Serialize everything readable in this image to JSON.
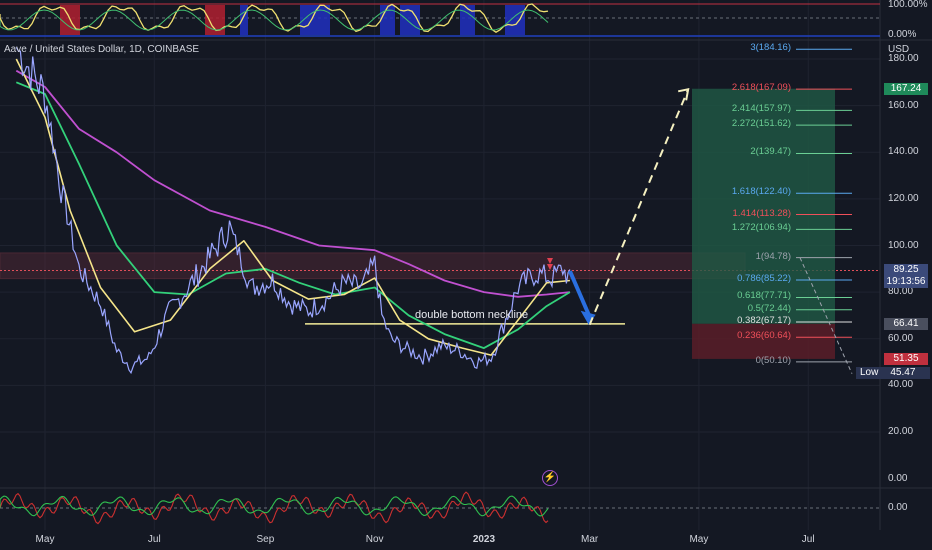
{
  "header": {
    "symbol_title": "Aave / United States Dollar, 1D, COINBASE",
    "currency": "USD"
  },
  "colors": {
    "bg": "#141823",
    "grid": "#1f2330",
    "up": "#9aa6ff",
    "ma_yellow": "#f5e58a",
    "ma_green": "#33d17a",
    "ma_magenta": "#c050d0",
    "resistance_line": "#e0505a",
    "neckline": "#f5ed9a",
    "take_profit_zone": "#1f5a45",
    "stop_zone": "#5e1e28",
    "fib_red": "#f0505a",
    "fib_green": "#6bcf94",
    "fib_blue": "#5aa9f0",
    "fib_grey": "#9ea3ad"
  },
  "annotation": {
    "neckline_label": "double bottom neckline"
  },
  "price_tags": {
    "target": "167.24",
    "current": "89.25",
    "countdown": "19:13:56",
    "neckline": "66.41",
    "stop": "51.35",
    "low_label": "Low",
    "low_value": "45.47"
  },
  "oscillator_top": {
    "ticks": [
      "100.00%",
      "0.00%"
    ]
  },
  "oscillator_bottom": {
    "ticks": [
      "0.00"
    ]
  },
  "chart_data": {
    "type": "line",
    "title": "Aave / United States Dollar, 1D, COINBASE",
    "ylabel": "USD",
    "ylim": [
      0,
      190
    ],
    "y_ticks": [
      "20.00",
      "40.00",
      "60.00",
      "80.00",
      "100.00",
      "120.00",
      "140.00",
      "160.00",
      "180.00"
    ],
    "x_ticks": [
      "May",
      "Jul",
      "Sep",
      "Nov",
      "2023",
      "Mar",
      "May",
      "Jul"
    ],
    "x_start": "2022-04-15",
    "series": [
      {
        "key": "price",
        "x": [
          "2022-04-15",
          "2022-05-01",
          "2022-05-10",
          "2022-05-20",
          "2022-06-01",
          "2022-06-10",
          "2022-06-18",
          "2022-06-28",
          "2022-07-08",
          "2022-07-20",
          "2022-08-01",
          "2022-08-12",
          "2022-08-24",
          "2022-09-05",
          "2022-09-15",
          "2022-09-25",
          "2022-10-05",
          "2022-10-15",
          "2022-10-25",
          "2022-11-01",
          "2022-11-05",
          "2022-11-10",
          "2022-11-18",
          "2022-11-28",
          "2022-12-08",
          "2022-12-18",
          "2022-12-28",
          "2023-01-05",
          "2023-01-12",
          "2023-01-20",
          "2023-01-30",
          "2023-02-08",
          "2023-02-14",
          "2023-02-18"
        ],
        "values": [
          185,
          165,
          125,
          90,
          75,
          55,
          48,
          52,
          70,
          82,
          95,
          108,
          82,
          85,
          75,
          72,
          77,
          84,
          82,
          92,
          70,
          60,
          56,
          52,
          57,
          55,
          50,
          52,
          66,
          82,
          88,
          86,
          90,
          85
        ]
      },
      {
        "key": "ma_yellow",
        "x": [
          "2022-04-15",
          "2022-05-01",
          "2022-05-15",
          "2022-06-01",
          "2022-06-20",
          "2022-07-10",
          "2022-08-01",
          "2022-08-20",
          "2022-09-05",
          "2022-09-25",
          "2022-10-15",
          "2022-11-01",
          "2022-11-15",
          "2022-12-01",
          "2022-12-20",
          "2023-01-05",
          "2023-01-20",
          "2023-02-05",
          "2023-02-18"
        ],
        "values": [
          180,
          155,
          115,
          82,
          63,
          68,
          90,
          102,
          85,
          77,
          79,
          86,
          68,
          60,
          56,
          53,
          68,
          84,
          85
        ]
      },
      {
        "key": "ma_green",
        "x": [
          "2022-04-15",
          "2022-05-01",
          "2022-05-20",
          "2022-06-10",
          "2022-07-01",
          "2022-07-20",
          "2022-08-10",
          "2022-09-01",
          "2022-09-20",
          "2022-10-10",
          "2022-11-01",
          "2022-11-20",
          "2022-12-10",
          "2023-01-01",
          "2023-01-20",
          "2023-02-05",
          "2023-02-18"
        ],
        "values": [
          170,
          165,
          135,
          100,
          80,
          79,
          88,
          90,
          84,
          79,
          82,
          70,
          62,
          56,
          64,
          74,
          80
        ]
      },
      {
        "key": "ma_magenta",
        "x": [
          "2022-04-15",
          "2022-05-01",
          "2022-05-20",
          "2022-06-10",
          "2022-07-01",
          "2022-08-01",
          "2022-09-01",
          "2022-10-01",
          "2022-11-01",
          "2022-11-20",
          "2022-12-10",
          "2023-01-01",
          "2023-01-20",
          "2023-02-05",
          "2023-02-18"
        ],
        "values": [
          175,
          168,
          150,
          140,
          128,
          115,
          108,
          100,
          98,
          92,
          85,
          80,
          78,
          79,
          80
        ]
      }
    ],
    "levels": {
      "resistance": 94.8,
      "neckline": 66.4,
      "fib_retracement": [
        {
          "label": "3(184.16)",
          "value": 184.16
        },
        {
          "label": "2.618(167.09)",
          "value": 167.09
        },
        {
          "label": "2.414(157.97)",
          "value": 157.97
        },
        {
          "label": "2.272(151.62)",
          "value": 151.62
        },
        {
          "label": "2(139.47)",
          "value": 139.47
        },
        {
          "label": "1.618(122.40)",
          "value": 122.4
        },
        {
          "label": "1.414(113.28)",
          "value": 113.28
        },
        {
          "label": "1.272(106.94)",
          "value": 106.94
        },
        {
          "label": "1(94.78)",
          "value": 94.78
        },
        {
          "label": "0.786(85.22)",
          "value": 85.22
        },
        {
          "label": "0.618(77.71)",
          "value": 77.71
        },
        {
          "label": "0.5(72.44)",
          "value": 72.44
        },
        {
          "label": "0.382(67.17)",
          "value": 67.17
        },
        {
          "label": "0.236(60.64)",
          "value": 60.64
        },
        {
          "label": "0(50.10)",
          "value": 50.1
        }
      ],
      "position": {
        "entry": 66.41,
        "target": 167.24,
        "stop": 51.35
      }
    },
    "projection": {
      "down_arrow": [
        {
          "x": "2023-02-18",
          "y": 89
        },
        {
          "x": "2023-03-01",
          "y": 66
        }
      ],
      "dashed_up": [
        {
          "x": "2023-03-01",
          "y": 66
        },
        {
          "x": "2023-04-25",
          "y": 167
        }
      ]
    }
  }
}
